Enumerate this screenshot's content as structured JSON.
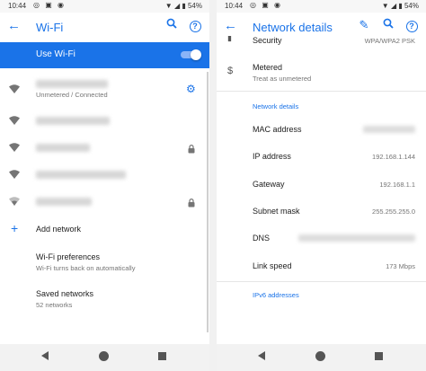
{
  "statusbar": {
    "time": "10:44",
    "battery": "54%"
  },
  "left": {
    "title": "Wi-Fi",
    "use_wifi_label": "Use Wi-Fi",
    "connected_status": "Unmetered / Connected",
    "add_network": "Add network",
    "preferences": {
      "title": "Wi-Fi preferences",
      "subtitle": "Wi-Fi turns back on automatically"
    },
    "saved": {
      "title": "Saved networks",
      "subtitle": "52 networks"
    }
  },
  "right": {
    "title": "Network details",
    "security_label": "Security",
    "security_value": "WPA/WPA2 PSK",
    "metered_label": "Metered",
    "metered_sub": "Treat as unmetered",
    "section_details": "Network details",
    "mac_label": "MAC address",
    "ip_label": "IP address",
    "ip_value": "192.168.1.144",
    "gateway_label": "Gateway",
    "gateway_value": "192.168.1.1",
    "subnet_label": "Subnet mask",
    "subnet_value": "255.255.255.0",
    "dns_label": "DNS",
    "link_label": "Link speed",
    "link_value": "173 Mbps",
    "section_ipv6": "IPv6 addresses"
  },
  "colors": {
    "accent": "#1a73e8"
  }
}
